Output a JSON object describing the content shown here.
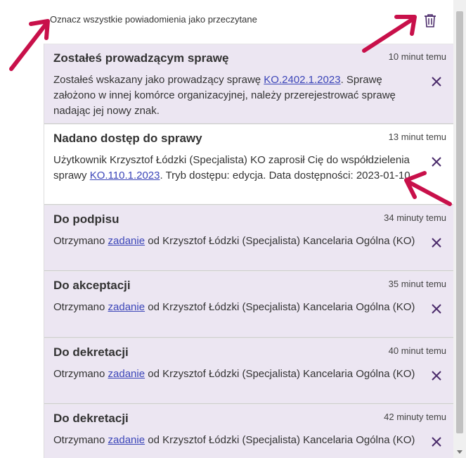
{
  "header": {
    "mark_all_read": "Oznacz wszystkie powiadomienia jako przeczytane",
    "trash_icon": "trash-icon"
  },
  "colors": {
    "unread_bg": "#ece6f2",
    "read_bg": "#ffffff",
    "link": "#3b45b8",
    "close_icon": "#4a2a6a",
    "annotation_arrows": "#c8104a"
  },
  "notifications": [
    {
      "title": "Zostałeś prowadzącym sprawę",
      "time": "10 minut temu",
      "state": "unread",
      "body_before": "Zostałeś wskazany jako prowadzący sprawę ",
      "link": "KO.2402.1.2023",
      "body_after": ". Sprawę założono w innej komórce organizacyjnej, należy przerejestrować sprawę nadając jej nowy znak."
    },
    {
      "title": "Nadano dostęp do sprawy",
      "time": "13 minut temu",
      "state": "read",
      "body_before": "Użytkownik Krzysztof Łódzki (Specjalista) KO zaprosił Cię do współdzielenia sprawy ",
      "link": "KO.110.1.2023",
      "body_after": ". Tryb dostępu: edycja. Data dostępności: 2023-01-10."
    },
    {
      "title": "Do podpisu",
      "time": "34 minuty temu",
      "state": "unread",
      "body_before": "Otrzymano ",
      "link": "zadanie",
      "body_after": " od Krzysztof Łódzki (Specjalista) Kancelaria Ogólna (KO)"
    },
    {
      "title": "Do akceptacji",
      "time": "35 minut temu",
      "state": "unread",
      "body_before": "Otrzymano ",
      "link": "zadanie",
      "body_after": " od Krzysztof Łódzki (Specjalista) Kancelaria Ogólna (KO)"
    },
    {
      "title": "Do dekretacji",
      "time": "40 minut temu",
      "state": "unread",
      "body_before": "Otrzymano ",
      "link": "zadanie",
      "body_after": " od Krzysztof Łódzki (Specjalista) Kancelaria Ogólna (KO)"
    },
    {
      "title": "Do dekretacji",
      "time": "42 minuty temu",
      "state": "unread",
      "body_before": "Otrzymano ",
      "link": "zadanie",
      "body_after": " od Krzysztof Łódzki (Specjalista) Kancelaria Ogólna (KO)"
    }
  ]
}
